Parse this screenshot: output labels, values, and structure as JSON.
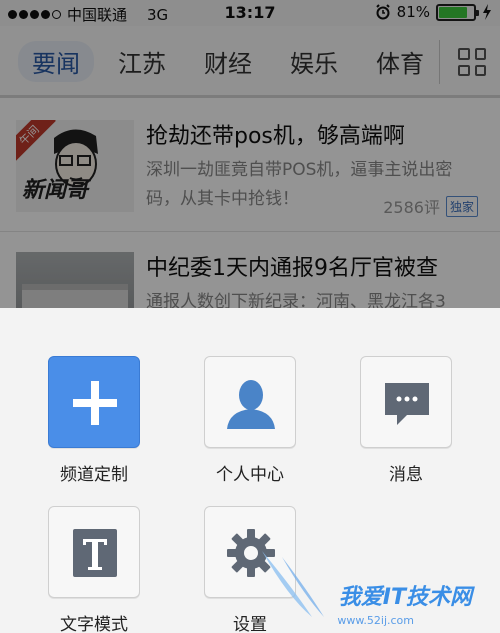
{
  "status_bar": {
    "carrier": "中国联通",
    "network": "3G",
    "time": "13:17",
    "battery": "81%",
    "battery_level": 0.81,
    "battery_color": "#3ecb3e"
  },
  "tabs": {
    "items": [
      "要闻",
      "江苏",
      "财经",
      "娱乐",
      "体育"
    ],
    "active": "要闻",
    "grid_icon": "grid-icon"
  },
  "news": [
    {
      "thumb_ribbon": "午间",
      "thumb_brand": "新闻哥",
      "title": "抢劫还带pos机，够高端啊",
      "summary": "深圳一劫匪竟自带POS机，逼事主说出密码，从其卡中抢钱！",
      "comments": "2586评",
      "badge": "独家"
    },
    {
      "title": "中纪委1天内通报9名厅官被查",
      "summary": "通报人数创下新纪录：河南、黑龙江各3"
    }
  ],
  "sheet": {
    "actions": [
      {
        "label": "频道定制",
        "icon": "plus-icon"
      },
      {
        "label": "个人中心",
        "icon": "person-icon"
      },
      {
        "label": "消息",
        "icon": "message-icon"
      },
      {
        "label": "文字模式",
        "icon": "text-mode-icon"
      },
      {
        "label": "设置",
        "icon": "gear-icon"
      }
    ]
  },
  "watermark": {
    "text": "我爱IT技术网",
    "url": "www.52ij.com"
  },
  "colors": {
    "accent": "#4a8ee8",
    "tab_active_text": "#2a5aa6",
    "icon_gray": "#5f6875",
    "person_icon": "#4a84c8"
  }
}
